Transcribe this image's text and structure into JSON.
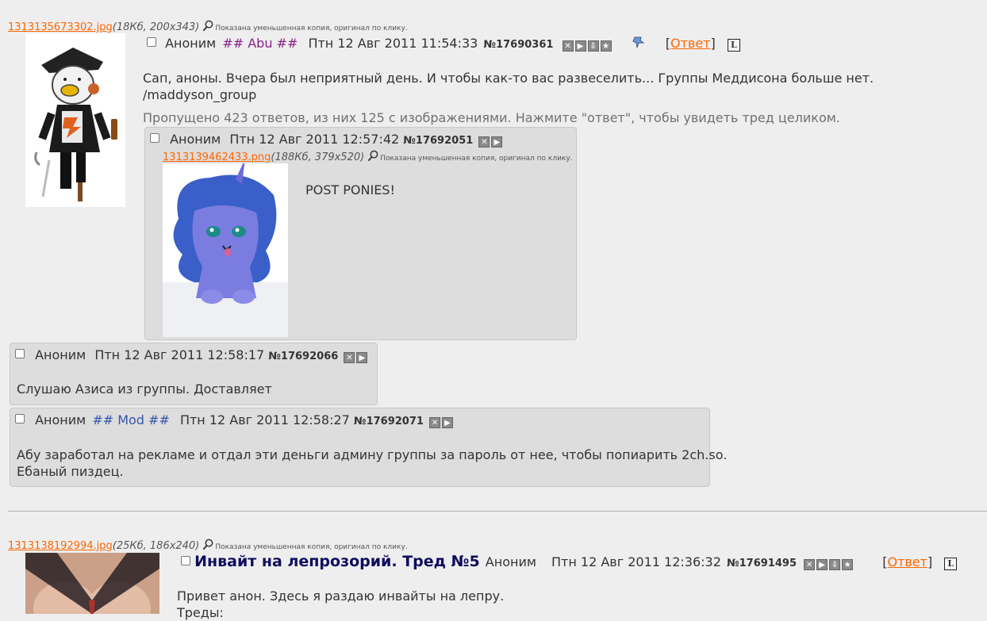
{
  "thread1": {
    "file_link": "1313135673302.jpg",
    "file_info": "(18Кб, 200x343)",
    "file_note": "Показана уменьшенная копия, оригинал по клику.",
    "name": "Аноним",
    "trip": "## Abu ##",
    "date": "Птн 12 Авг 2011 11:54:33",
    "post_number": "№17690361",
    "reply_label": "Ответ",
    "message_line1": "Сап, аноны. Вчера был неприятный день. И чтобы как-то вас развеселить... Группы Меддисона больше нет.",
    "message_line2": "/maddyson_group",
    "omitted": "Пропущено 423 ответов, из них 125 с изображениями. Нажмите \"ответ\", чтобы увидеть тред целиком."
  },
  "replies": [
    {
      "name": "Аноним",
      "date": "Птн 12 Авг 2011 12:57:42",
      "post_number": "№17692051",
      "file_link": "1313139462433.png",
      "file_info": "(188Кб, 379x520)",
      "file_note": "Показана уменьшенная копия, оригинал по клику.",
      "message": "POST PONIES!"
    },
    {
      "name": "Аноним",
      "date": "Птн 12 Авг 2011 12:58:17",
      "post_number": "№17692066",
      "message": "Слушаю Азиса из группы. Доставляет"
    },
    {
      "name": "Аноним",
      "trip": "## Mod ##",
      "date": "Птн 12 Авг 2011 12:58:27",
      "post_number": "№17692071",
      "message_line1": "Абу заработал на рекламе и отдал эти деньги админу группы за пароль от нее, чтобы попиарить 2ch.so.",
      "message_line2": "Ебаный пиздец."
    }
  ],
  "thread2": {
    "file_link": "1313138192994.jpg",
    "file_info": "(25Кб, 186x240)",
    "file_note": "Показана уменьшенная копия, оригинал по клику.",
    "subject": "Инвайт на лепрозорий. Тред №5",
    "name": "Аноним",
    "date": "Птн 12 Авг 2011 12:36:32",
    "post_number": "№17691495",
    "reply_label": "Ответ",
    "message_line1": "Привет анон. Здесь я раздаю инвайты на лепру.",
    "message_line2": "Треды:"
  },
  "icons": {
    "hide": "hide-icon",
    "play": "expand-icon",
    "download": "download-icon",
    "favorite": "star-icon",
    "pin": "pin-icon",
    "magnifier": "magnifier-icon",
    "lock": "l-icon"
  }
}
